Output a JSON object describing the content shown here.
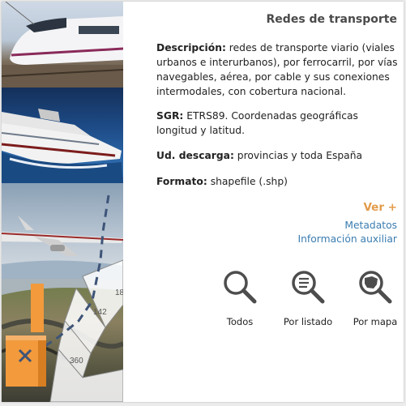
{
  "header": {
    "title": "Redes de transporte"
  },
  "info": {
    "descripcion_label": "Descripción:",
    "descripcion_text": " redes de transporte viario (viales urbanos e interurbanos), por ferrocarril, por vías navegables, aérea, por cable y sus conexiones intermodales, con cobertura nacional.",
    "sgr_label": "SGR:",
    "sgr_text": " ETRS89. Coordenadas geográficas longitud y latitud.",
    "descarga_label": "Ud. descarga:",
    "descarga_text": " provincias y toda España",
    "formato_label": "Formato:",
    "formato_text": " shapefile (.shp)"
  },
  "links": {
    "ver_mas": "Ver +",
    "metadatos": "Metadatos",
    "info_aux": "Información auxiliar"
  },
  "tools": {
    "todos": "Todos",
    "por_listado": "Por listado",
    "por_mapa": "Por mapa"
  },
  "map_labels": {
    "parcel_a": "142",
    "parcel_b": "360",
    "parcel_c": "18"
  },
  "icons": {
    "todos": "magnifier-icon",
    "por_listado": "magnifier-list-icon",
    "por_mapa": "magnifier-map-icon"
  },
  "colors": {
    "accent_orange": "#e39b4a",
    "link_blue": "#3b7db0",
    "icon_gray": "#4d4d4d",
    "map_orange": "#f29a3c"
  }
}
